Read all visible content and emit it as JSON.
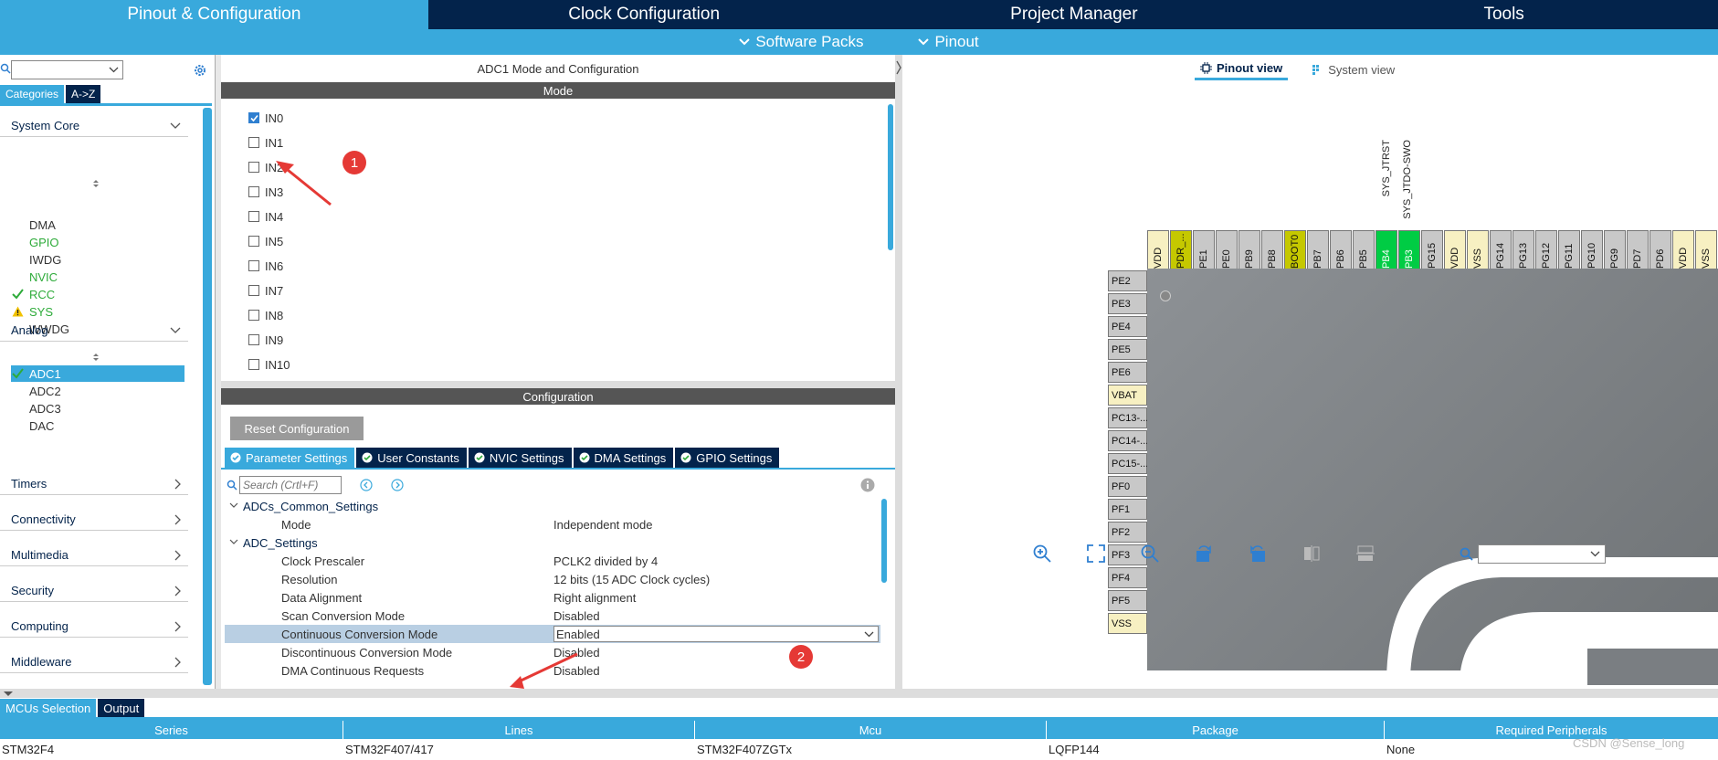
{
  "top_tabs": [
    "Pinout & Configuration",
    "Clock Configuration",
    "Project Manager",
    "Tools"
  ],
  "sub_nav": [
    "Software Packs",
    "Pinout"
  ],
  "left": {
    "category_tabs": [
      "Categories",
      "A->Z"
    ],
    "sections": {
      "system_core": "System Core",
      "analog": "Analog",
      "timers": "Timers",
      "connectivity": "Connectivity",
      "multimedia": "Multimedia",
      "security": "Security",
      "computing": "Computing",
      "middleware": "Middleware"
    },
    "system_core_items": [
      "DMA",
      "GPIO",
      "IWDG",
      "NVIC",
      "RCC",
      "SYS",
      "WWDG"
    ],
    "analog_items": [
      "ADC1",
      "ADC2",
      "ADC3",
      "DAC"
    ]
  },
  "mid": {
    "title": "ADC1 Mode and Configuration",
    "mode_header": "Mode",
    "channels": [
      "IN0",
      "IN1",
      "IN2",
      "IN3",
      "IN4",
      "IN5",
      "IN6",
      "IN7",
      "IN8",
      "IN9",
      "IN10"
    ],
    "config_header": "Configuration",
    "reset_label": "Reset Configuration",
    "config_tabs": [
      "Parameter Settings",
      "User Constants",
      "NVIC Settings",
      "DMA Settings",
      "GPIO Settings"
    ],
    "search_placeholder": "Search (Crtl+F)",
    "params": {
      "group1": "ADCs_Common_Settings",
      "mode_k": "Mode",
      "mode_v": "Independent mode",
      "group2": "ADC_Settings",
      "clk_k": "Clock Prescaler",
      "clk_v": "PCLK2 divided by 4",
      "res_k": "Resolution",
      "res_v": "12 bits (15 ADC Clock cycles)",
      "align_k": "Data Alignment",
      "align_v": "Right alignment",
      "scan_k": "Scan Conversion Mode",
      "scan_v": "Disabled",
      "cont_k": "Continuous Conversion Mode",
      "cont_v": "Enabled",
      "disc_k": "Discontinuous Conversion Mode",
      "disc_v": "Disabled",
      "dma_k": "DMA Continuous Requests",
      "dma_v": "Disabled"
    },
    "annotations": [
      "1",
      "2"
    ]
  },
  "right": {
    "view_tabs": [
      "Pinout view",
      "System view"
    ],
    "signals": [
      "SYS_JTRST",
      "SYS_JTDO-SWO"
    ],
    "top_pins": [
      "VDD",
      "PDR_...",
      "PE1",
      "PE0",
      "PB9",
      "PB8",
      "BOOT0",
      "PB7",
      "PB6",
      "PB5",
      "PB4",
      "PB3",
      "PG15",
      "VDD",
      "VSS",
      "PG14",
      "PG13",
      "PG12",
      "PG11",
      "PG10",
      "PG9",
      "PD7",
      "PD6",
      "VDD",
      "VSS"
    ],
    "left_pins": [
      "PE2",
      "PE3",
      "PE4",
      "PE5",
      "PE6",
      "VBAT",
      "PC13-...",
      "PC14-...",
      "PC15-...",
      "PF0",
      "PF1",
      "PF2",
      "PF3",
      "PF4",
      "PF5",
      "VSS"
    ]
  },
  "bottom": {
    "tabs": [
      "MCUs Selection",
      "Output"
    ],
    "columns": [
      "Series",
      "Lines",
      "Mcu",
      "Package",
      "Required Peripherals"
    ],
    "row": [
      "STM32F4",
      "STM32F407/417",
      "STM32F407ZGTx",
      "LQFP144",
      "None"
    ],
    "watermark": "CSDN @Sense_long"
  },
  "colors": {
    "accent": "#39a9dc",
    "navy": "#03234b",
    "pin_green": "#00cc44",
    "pin_yellow": "#c5c800",
    "pin_power": "#f7f0c2",
    "annotation_red": "#e53935"
  }
}
